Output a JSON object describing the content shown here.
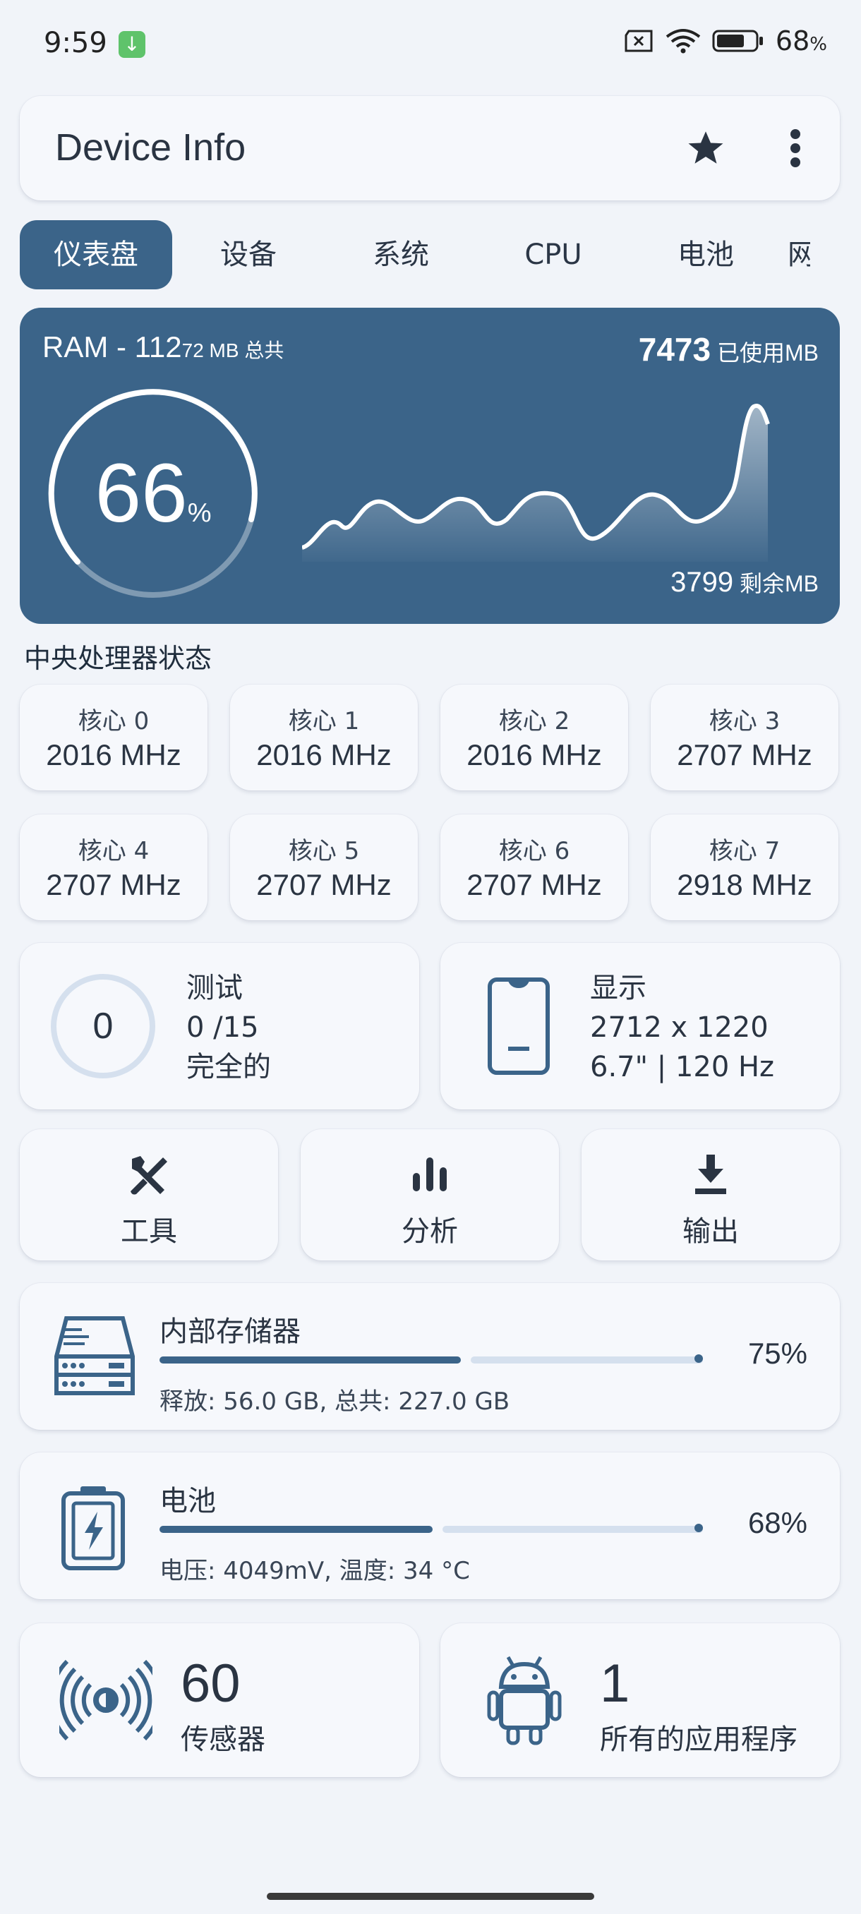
{
  "status_bar": {
    "time": "9:59",
    "battery_value": "68",
    "battery_unit": "%"
  },
  "app_bar": {
    "title": "Device Info"
  },
  "tabs": [
    "仪表盘",
    "设备",
    "系统",
    "CPU",
    "电池",
    "网"
  ],
  "ram": {
    "title_main": "RAM - 112",
    "title_small": "72 MB 总共",
    "percent": "66",
    "percent_unit": "%",
    "used_value": "7473",
    "used_label": " 已使用MB",
    "free_value": "3799",
    "free_label": " 剩余MB"
  },
  "cpu_section": {
    "title": "中央处理器状态",
    "cores": [
      {
        "name": "核心 0",
        "freq": "2016 MHz"
      },
      {
        "name": "核心 1",
        "freq": "2016 MHz"
      },
      {
        "name": "核心 2",
        "freq": "2016 MHz"
      },
      {
        "name": "核心 3",
        "freq": "2707 MHz"
      },
      {
        "name": "核心 4",
        "freq": "2707 MHz"
      },
      {
        "name": "核心 5",
        "freq": "2707 MHz"
      },
      {
        "name": "核心 6",
        "freq": "2707 MHz"
      },
      {
        "name": "核心 7",
        "freq": "2918 MHz"
      }
    ]
  },
  "test_card": {
    "count": "0",
    "title": "测试",
    "progress": "0 /15",
    "status": "完全的"
  },
  "display_card": {
    "title": "显示",
    "resolution": "2712 x 1220",
    "details": "6.7\" | 120 Hz"
  },
  "actions": {
    "tools": "工具",
    "analysis": "分析",
    "export": "输出"
  },
  "storage": {
    "title": "内部存储器",
    "sub": "释放: 56.0 GB,  总共: 227.0 GB",
    "percent": "75%",
    "fill": 0.75
  },
  "battery": {
    "title": "电池",
    "sub": "电压: 4049mV,  温度: 34 °C",
    "percent": "68%",
    "fill": 0.68
  },
  "sensors": {
    "count": "60",
    "label": "传感器"
  },
  "apps": {
    "count": "1",
    "label": "所有的应用程序"
  },
  "colors": {
    "accent": "#3b6489",
    "background": "#f1f4f9",
    "card": "#f6f8fc"
  }
}
